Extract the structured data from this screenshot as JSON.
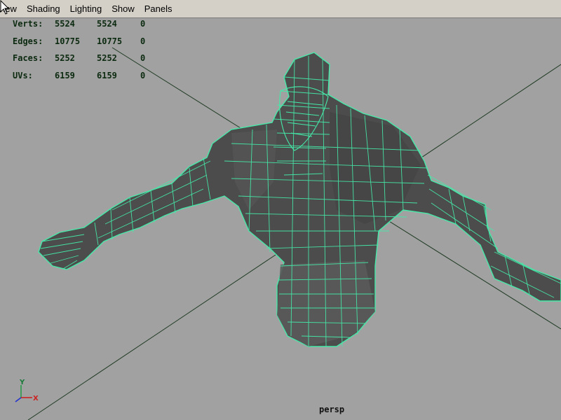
{
  "menu": [
    "View",
    "Shading",
    "Lighting",
    "Show",
    "Panels"
  ],
  "stats": [
    {
      "label": "Verts:",
      "total": "5524",
      "selected": "5524",
      "extra": "0"
    },
    {
      "label": "Edges:",
      "total": "10775",
      "selected": "10775",
      "extra": "0"
    },
    {
      "label": "Faces:",
      "total": "5252",
      "selected": "5252",
      "extra": "0"
    },
    {
      "label": "UVs:",
      "total": "6159",
      "selected": "6159",
      "extra": "0"
    }
  ],
  "camera": "persp",
  "axis": {
    "y": "Y",
    "x": "X"
  },
  "colors": {
    "wire": "#45e9a8",
    "body": "#4a4a4a",
    "grid": "#1e3a22",
    "background": "#a1a1a1",
    "menubar": "#d4d0c8"
  }
}
